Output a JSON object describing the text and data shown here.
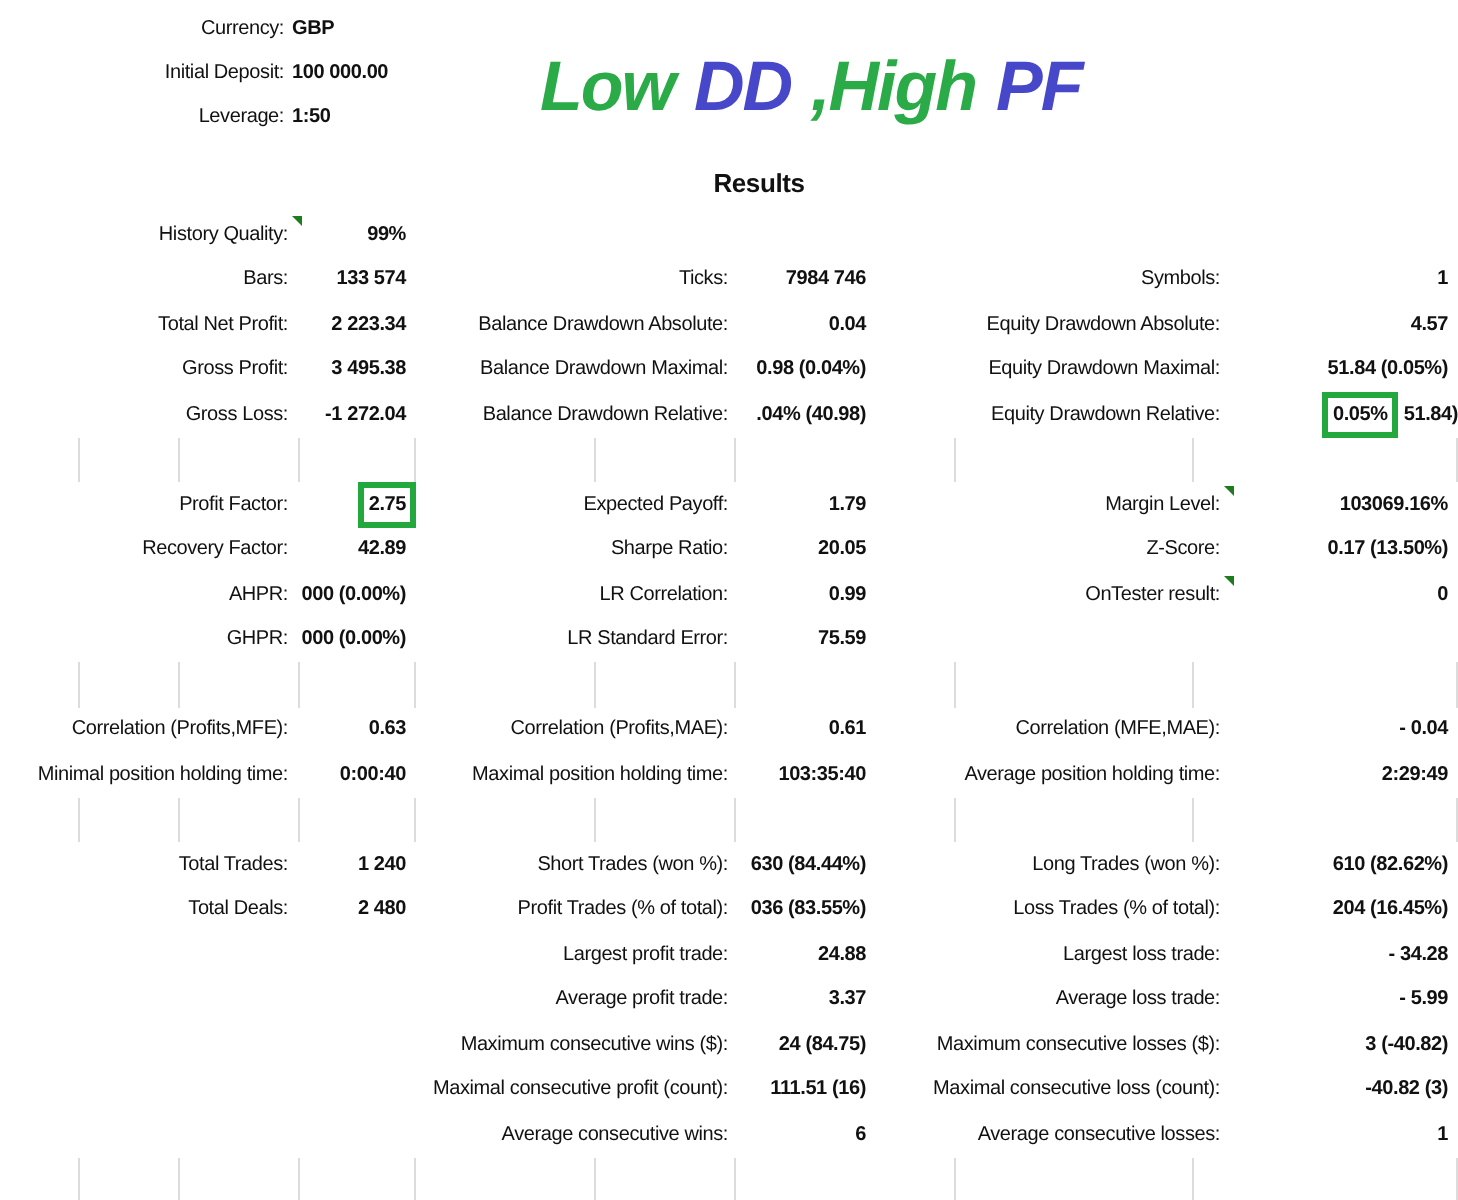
{
  "settings": [
    {
      "label": "Currency:",
      "value": "GBP"
    },
    {
      "label": "Initial Deposit:",
      "value": "100 000.00"
    },
    {
      "label": "Leverage:",
      "value": "1:50"
    }
  ],
  "banner": [
    {
      "text": "Low",
      "color": "#2bab48"
    },
    {
      "text": "DD",
      "color": "#4747c9"
    },
    {
      "text": ",High",
      "color": "#2bab48"
    },
    {
      "text": "PF",
      "color": "#4747c9"
    }
  ],
  "results_title": "Results",
  "sections": [
    {
      "rows": [
        [
          {
            "label": "History Quality:",
            "value": "99%",
            "note_marker": true,
            "highlighted": false
          },
          null,
          null
        ],
        [
          {
            "label": "Bars:",
            "value": "133 574",
            "note_marker": false,
            "highlighted": false
          },
          {
            "label": "Ticks:",
            "value": "7984 746",
            "note_marker": false,
            "highlighted": false
          },
          {
            "label": "Symbols:",
            "value": "1",
            "note_marker": false,
            "highlighted": false
          }
        ],
        [
          {
            "label": "Total Net Profit:",
            "value": "2 223.34",
            "note_marker": false,
            "highlighted": false
          },
          {
            "label": "Balance Drawdown Absolute:",
            "value": "0.04",
            "note_marker": false,
            "highlighted": false
          },
          {
            "label": "Equity Drawdown Absolute:",
            "value": "4.57",
            "note_marker": false,
            "highlighted": false
          }
        ],
        [
          {
            "label": "Gross Profit:",
            "value": "3 495.38",
            "note_marker": false,
            "highlighted": false
          },
          {
            "label": "Balance Drawdown Maximal:",
            "value": "0.98 (0.04%)",
            "note_marker": false,
            "highlighted": false
          },
          {
            "label": "Equity Drawdown Maximal:",
            "value": "51.84 (0.05%)",
            "note_marker": false,
            "highlighted": false
          }
        ],
        [
          {
            "label": "Gross Loss:",
            "value": "-1 272.04",
            "note_marker": false,
            "highlighted": false
          },
          {
            "label": "Balance Drawdown Relative:",
            "value": ".04% (40.98)",
            "note_marker": false,
            "highlighted": false
          },
          {
            "label": "Equity Drawdown Relative:",
            "value": "0.05%",
            "value_2": "51.84)",
            "note_marker": false,
            "highlighted": true
          }
        ]
      ]
    },
    {
      "rows": [
        [
          {
            "label": "Profit Factor:",
            "value": "2.75",
            "note_marker": false,
            "highlighted": true
          },
          {
            "label": "Expected Payoff:",
            "value": "1.79",
            "note_marker": false,
            "highlighted": false
          },
          {
            "label": "Margin Level:",
            "value": "103069.16%",
            "note_marker": true,
            "highlighted": false
          }
        ],
        [
          {
            "label": "Recovery Factor:",
            "value": "42.89",
            "note_marker": false,
            "highlighted": false
          },
          {
            "label": "Sharpe Ratio:",
            "value": "20.05",
            "note_marker": false,
            "highlighted": false
          },
          {
            "label": "Z-Score:",
            "value": "0.17 (13.50%)",
            "note_marker": false,
            "highlighted": false
          }
        ],
        [
          {
            "label": "AHPR:",
            "value": "000 (0.00%)",
            "note_marker": false,
            "highlighted": false
          },
          {
            "label": "LR Correlation:",
            "value": "0.99",
            "note_marker": false,
            "highlighted": false
          },
          {
            "label": "OnTester result:",
            "value": "0",
            "note_marker": true,
            "highlighted": false
          }
        ],
        [
          {
            "label": "GHPR:",
            "value": "000 (0.00%)",
            "note_marker": false,
            "highlighted": false
          },
          {
            "label": "LR Standard Error:",
            "value": "75.59",
            "note_marker": false,
            "highlighted": false
          },
          null
        ]
      ]
    },
    {
      "rows": [
        [
          {
            "label": "Correlation (Profits,MFE):",
            "value": "0.63",
            "note_marker": false,
            "highlighted": false
          },
          {
            "label": "Correlation (Profits,MAE):",
            "value": "0.61",
            "note_marker": false,
            "highlighted": false
          },
          {
            "label": "Correlation (MFE,MAE):",
            "value": "- 0.04",
            "note_marker": false,
            "highlighted": false
          }
        ],
        [
          {
            "label": "Minimal position holding time:",
            "value": "0:00:40",
            "note_marker": false,
            "highlighted": false
          },
          {
            "label": "Maximal position holding time:",
            "value": "103:35:40",
            "note_marker": false,
            "highlighted": false
          },
          {
            "label": "Average position holding time:",
            "value": "2:29:49",
            "note_marker": false,
            "highlighted": false
          }
        ]
      ]
    },
    {
      "rows": [
        [
          {
            "label": "Total Trades:",
            "value": "1 240",
            "note_marker": false,
            "highlighted": false
          },
          {
            "label": "Short Trades (won %):",
            "value": "630 (84.44%)",
            "note_marker": false,
            "highlighted": false
          },
          {
            "label": "Long Trades (won %):",
            "value": "610 (82.62%)",
            "note_marker": false,
            "highlighted": false
          }
        ],
        [
          {
            "label": "Total Deals:",
            "value": "2 480",
            "note_marker": false,
            "highlighted": false
          },
          {
            "label": "Profit Trades (% of total):",
            "value": "036 (83.55%)",
            "note_marker": false,
            "highlighted": false
          },
          {
            "label": "Loss Trades (% of total):",
            "value": "204 (16.45%)",
            "note_marker": false,
            "highlighted": false
          }
        ],
        [
          null,
          {
            "label": "Largest profit trade:",
            "value": "24.88",
            "note_marker": false,
            "highlighted": false
          },
          {
            "label": "Largest loss trade:",
            "value": "- 34.28",
            "note_marker": false,
            "highlighted": false
          }
        ],
        [
          null,
          {
            "label": "Average profit trade:",
            "value": "3.37",
            "note_marker": false,
            "highlighted": false
          },
          {
            "label": "Average loss trade:",
            "value": "- 5.99",
            "note_marker": false,
            "highlighted": false
          }
        ],
        [
          null,
          {
            "label": "Maximum consecutive wins ($):",
            "value": "24 (84.75)",
            "note_marker": false,
            "highlighted": false
          },
          {
            "label": "Maximum consecutive losses ($):",
            "value": "3 (-40.82)",
            "note_marker": false,
            "highlighted": false
          }
        ],
        [
          null,
          {
            "label": "Maximal consecutive profit (count):",
            "value": "111.51 (16)",
            "note_marker": false,
            "highlighted": false
          },
          {
            "label": "Maximal consecutive loss (count):",
            "value": "-40.82 (3)",
            "note_marker": false,
            "highlighted": false
          }
        ],
        [
          null,
          {
            "label": "Average consecutive wins:",
            "value": "6",
            "note_marker": false,
            "highlighted": false
          },
          {
            "label": "Average consecutive losses:",
            "value": "1",
            "note_marker": false,
            "highlighted": false
          }
        ]
      ]
    }
  ]
}
